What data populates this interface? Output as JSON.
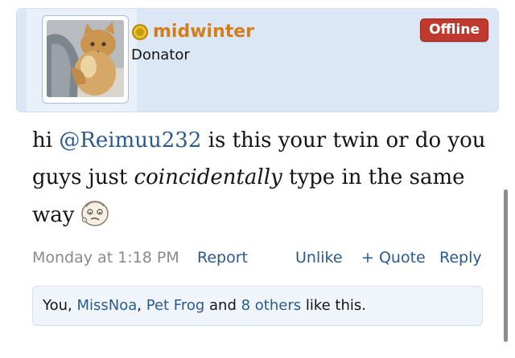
{
  "post": {
    "author": {
      "username": "midwinter",
      "title": "Donator",
      "status": "Offline",
      "avatar": "avatar-image",
      "status_icon": "user-status-icon"
    },
    "message": {
      "greeting": "hi ",
      "mention": "@Reimuu232",
      "text_before": " is this your twin or do you guys just ",
      "emphasis": "coincidentally",
      "text_after": " type in the same way",
      "smilie": "confused-face-smilie"
    },
    "meta": {
      "date": "Monday at 1:18 PM",
      "report": "Report",
      "unlike": "Unlike",
      "quote": "+ Quote",
      "reply": "Reply"
    },
    "likes": {
      "you": "You",
      "sep1": ", ",
      "user1": "MissNoa",
      "sep2": ", ",
      "user2": "Pet Frog",
      "and": " and ",
      "others": "8 others",
      "suffix": " like this."
    }
  },
  "colors": {
    "username": "#d47d1a",
    "link": "#2b5a8f",
    "badge": "#c0392e",
    "panel": "#dce7f5"
  }
}
